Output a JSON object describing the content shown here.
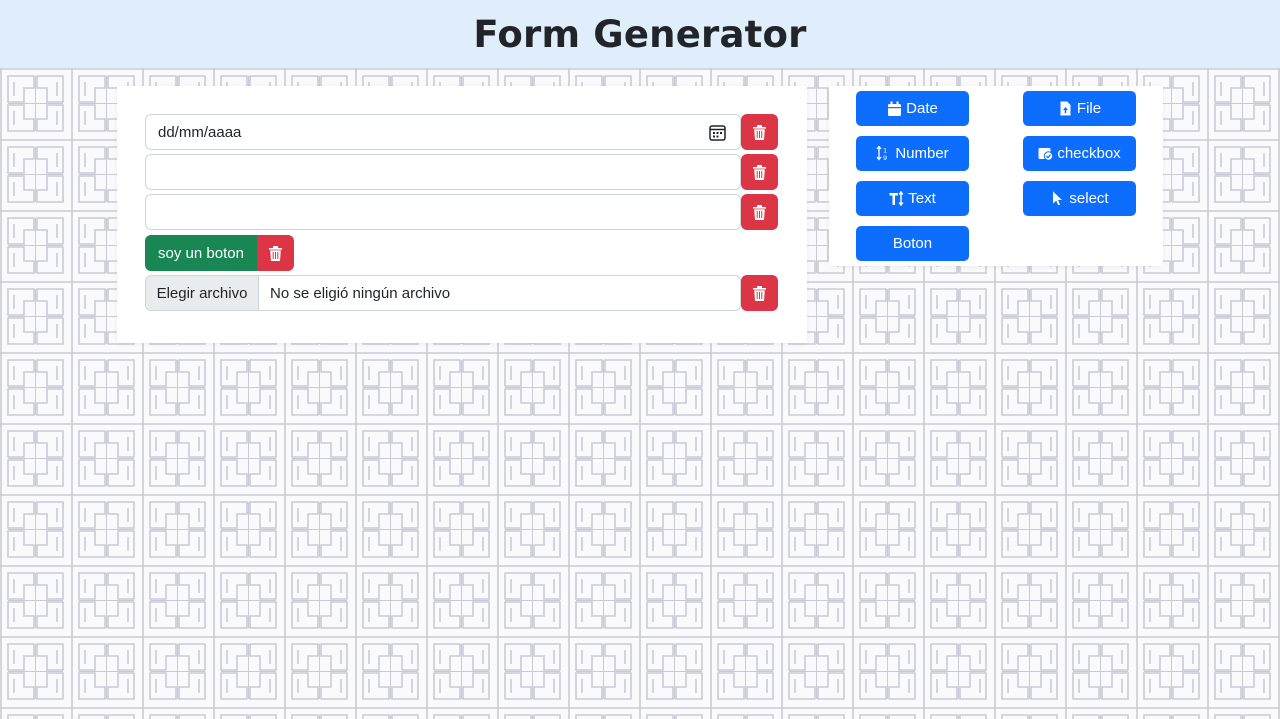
{
  "header": {
    "title": "Form Generator"
  },
  "form": {
    "date_placeholder": "dd/mm/aaaa",
    "text_field_1_value": "",
    "text_field_2_value": "",
    "green_button_label": "soy un boton",
    "file_choose_label": "Elegir archivo",
    "file_status": "No se eligió ningún archivo"
  },
  "tools": {
    "date_label": "Date",
    "file_label": "File",
    "number_label": "Number",
    "checkbox_label": "checkbox",
    "text_label": "Text",
    "select_label": "select",
    "boton_label": "Boton"
  },
  "colors": {
    "header_bg": "#e0eefb",
    "primary": "#0d6efd",
    "danger": "#dc3545",
    "success": "#198754",
    "pattern_line": "#c9cad6"
  },
  "icons": [
    "calendar-icon",
    "trash-icon",
    "calendar-alt-icon",
    "file-upload-icon",
    "sort-numeric-icon",
    "calendar-check-icon",
    "text-height-icon",
    "mouse-pointer-icon"
  ]
}
